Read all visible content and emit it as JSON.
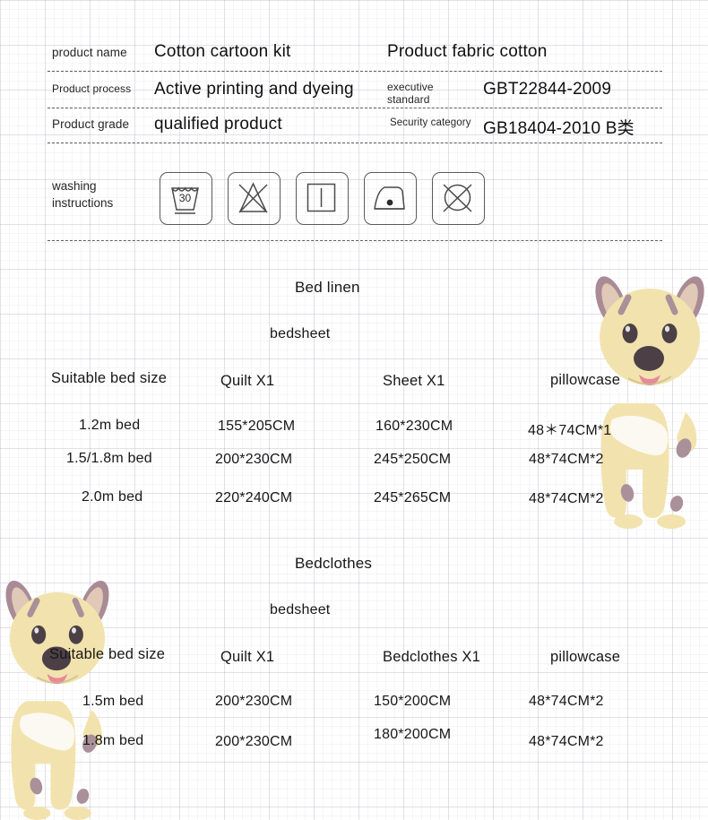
{
  "spec": {
    "rows": [
      {
        "left_label": "product name",
        "left_value": "Cotton cartoon kit",
        "right_label": "",
        "right_value": "Product fabric cotton"
      },
      {
        "left_label": "Product process",
        "left_value": "Active printing and dyeing",
        "right_label": "executive standard",
        "right_value": "GBT22844-2009"
      },
      {
        "left_label": "Product grade",
        "left_value": "qualified product",
        "right_label": "Security category",
        "right_value": "GB18404-2010 B类"
      }
    ],
    "executive_label_line1": "executive",
    "executive_label_line2": "standard"
  },
  "washing": {
    "label_line1": "washing",
    "label_line2": "instructions",
    "icons": [
      {
        "name": "wash-30-icon",
        "temperature": "30"
      },
      {
        "name": "do-not-bleach-icon",
        "temperature": ""
      },
      {
        "name": "drip-dry-icon",
        "temperature": ""
      },
      {
        "name": "iron-low-heat-icon",
        "temperature": ""
      },
      {
        "name": "do-not-tumble-dry-icon",
        "temperature": ""
      }
    ]
  },
  "tables": [
    {
      "title": "Bed linen",
      "subtitle": "bedsheet",
      "headers": [
        "Suitable bed size",
        "Quilt X1",
        "Sheet X1",
        "pillowcase"
      ],
      "rows": [
        [
          "1.2m bed",
          "155*205CM",
          "160*230CM",
          "48＊74CM*1"
        ],
        [
          "1.5/1.8m bed",
          "200*230CM",
          "245*250CM",
          "48*74CM*2"
        ],
        [
          "2.0m bed",
          "220*240CM",
          "245*265CM",
          "48*74CM*2"
        ]
      ]
    },
    {
      "title": "Bedclothes",
      "subtitle": "bedsheet",
      "headers": [
        "Suitable bed size",
        "Quilt X1",
        "Bedclothes X1",
        "pillowcase"
      ],
      "rows": [
        [
          "1.5m bed",
          "200*230CM",
          "150*200CM",
          "48*74CM*2"
        ],
        [
          "1.8m bed",
          "200*230CM",
          "180*200CM",
          "48*74CM*2"
        ]
      ]
    }
  ],
  "mascot": {
    "name": "cartoon-dog-mascot",
    "body_color": "#f2e3ae",
    "body_shade": "#e4d08f",
    "ear_color": "#a98b96",
    "spot_color": "#a99099",
    "eye_color": "#4c4046",
    "nose_color": "#4c4046",
    "tongue_color": "#e8889a",
    "towel_color": "#fbfaf4"
  }
}
